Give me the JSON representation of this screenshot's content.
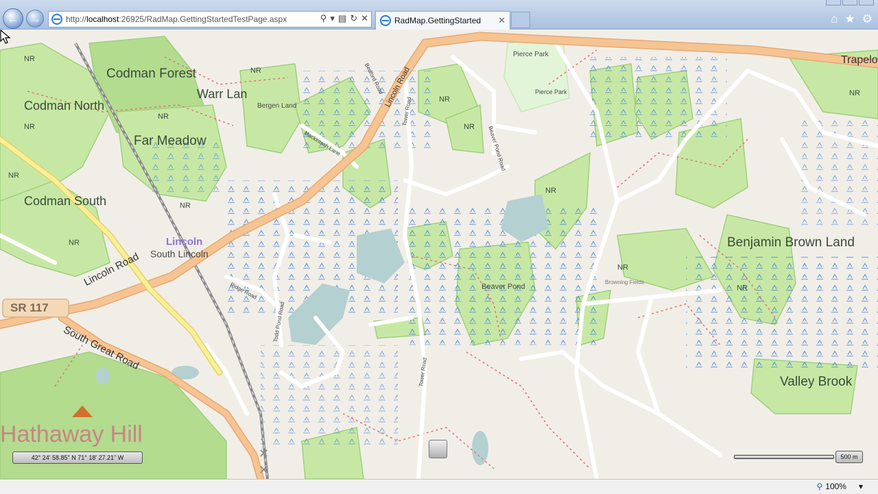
{
  "browser": {
    "address_protocol": "http://",
    "address_host": "localhost",
    "address_rest": ":26925/RadMap.GettingStartedTestPage.aspx",
    "tab_title": "RadMap.GettingStarted",
    "back_icon": "arrow-left-icon",
    "forward_icon": "arrow-right-icon",
    "home_icon": "home-icon",
    "favorites_icon": "star-icon",
    "tools_icon": "gear-icon"
  },
  "map": {
    "labels": {
      "codman_forest": "Codman Forest",
      "codman_north": "Codman North",
      "far_meadow": "Far Meadow",
      "codman_south": "Codman South",
      "warr_land": "Warr Lan",
      "bergen_land": "Bergen Land",
      "pierce_park_1": "Pierce Park",
      "pierce_park_2": "Pierce Park",
      "lincoln": "Lincoln",
      "south_lincoln": "South Lincoln",
      "lincoln_road_1": "Lincoln Road",
      "lincoln_road_2": "Lincoln Road",
      "sr117": "SR 117",
      "south_great_road": "South Great Road",
      "hathaway_hill": "Hathaway Hill",
      "beaver_pond": "Beaver Pond",
      "benjamin_brown_land": "Benjamin Brown Land",
      "valley_brook": "Valley Brook",
      "trapelo": "Trapelo",
      "tower_road_1": "Tower Road",
      "tower_road_2": "Tower Road",
      "mackintosh_lane": "Mackintosh Lane",
      "beaver_pond_road": "Beaver Pond Road",
      "ridge_road": "Ridge Road",
      "todd_pond_road": "Todd Pond Road",
      "bedford_road": "Bedford Road",
      "browning_fields": "Browning Fields",
      "nr": "NR"
    },
    "coordinates": "42° 24' 58.85\" N 71° 18' 27.21\" W",
    "scale_label": "500 m"
  },
  "status": {
    "zoom": "100%"
  },
  "colors": {
    "land": "#f1eee8",
    "park": "#c7e8a5",
    "park_border": "#9fcf7a",
    "forest": "#b3dc8f",
    "water": "#b5d0d0",
    "road_major": "#f6c493",
    "road_minor": "#ffffff",
    "trail": "#e0766d",
    "marsh": "#3f7fd6"
  }
}
